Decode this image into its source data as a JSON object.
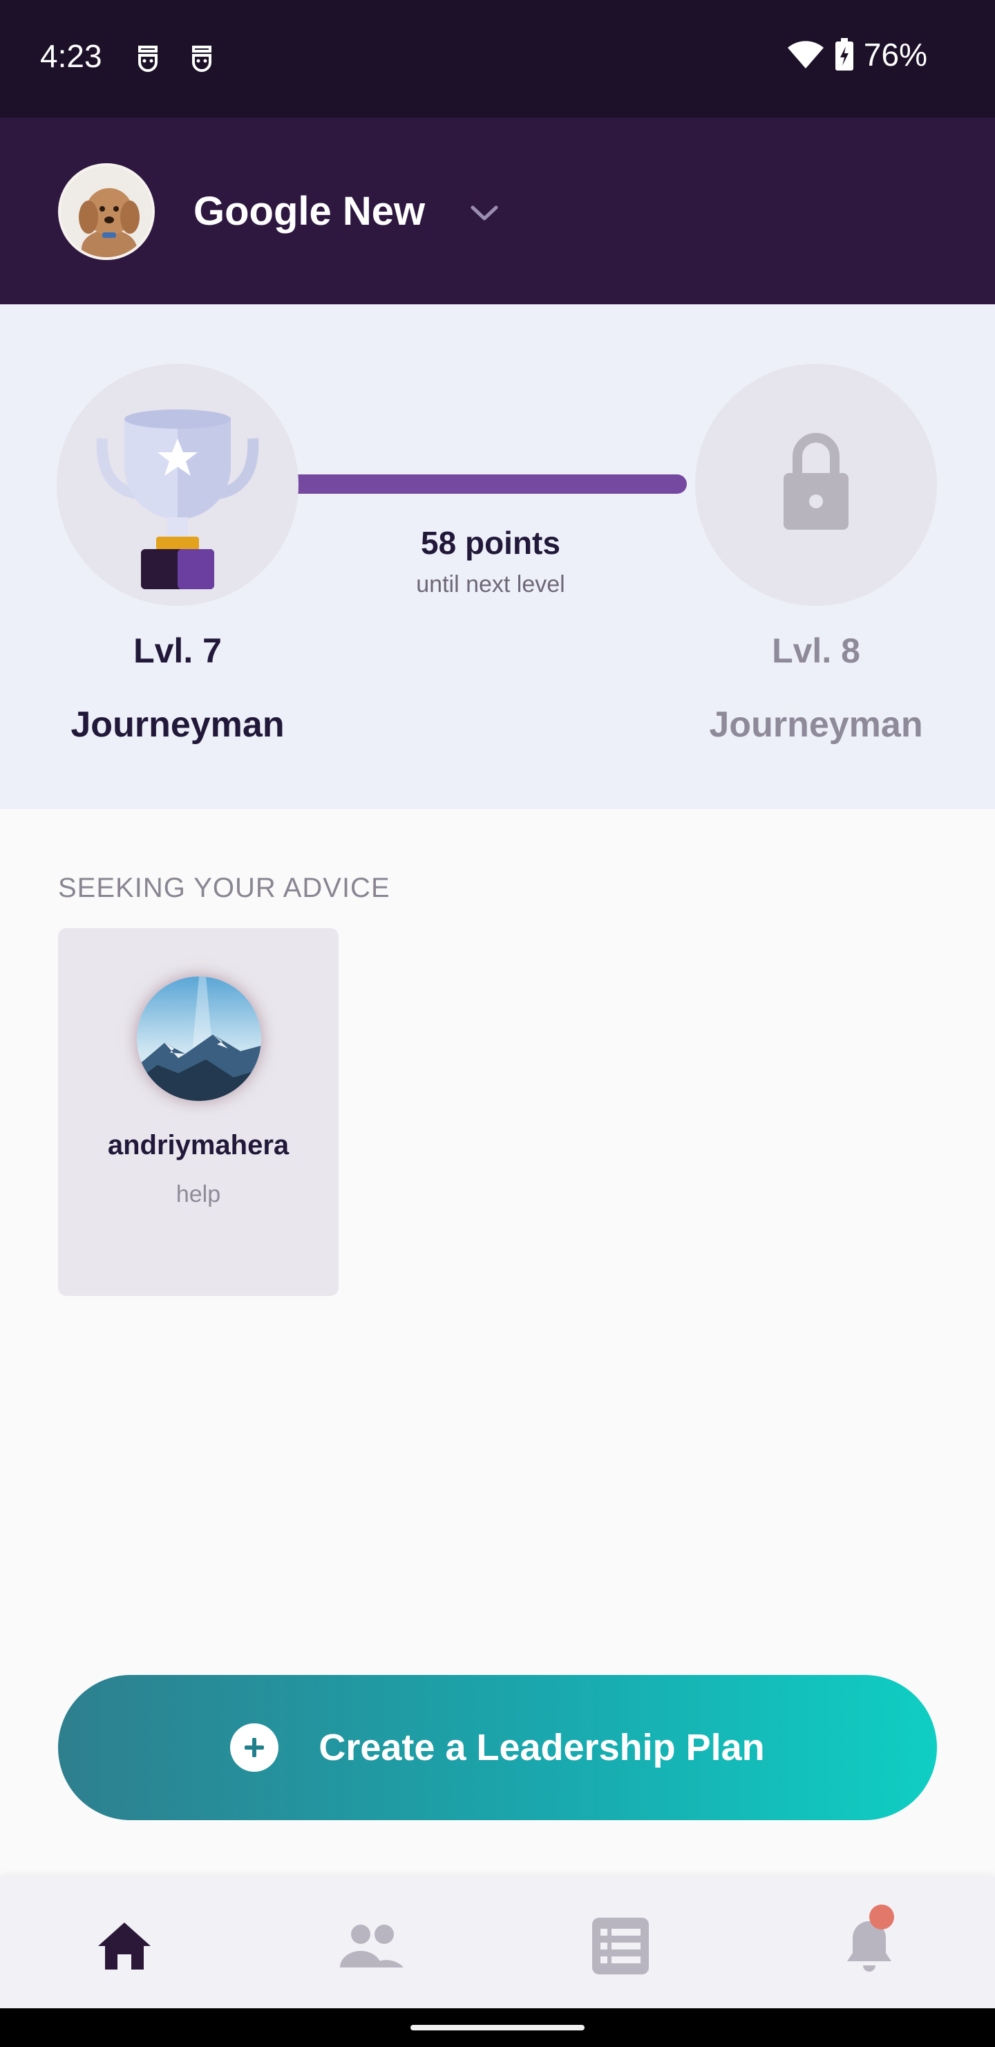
{
  "status_bar": {
    "time": "4:23",
    "battery": "76%",
    "icons": [
      "notification-icon",
      "notification-icon",
      "wifi-icon",
      "battery-charging-icon"
    ]
  },
  "header": {
    "org_name": "Google New",
    "icons": [
      "avatar",
      "chevron-down-icon"
    ]
  },
  "progress": {
    "points": "58 points",
    "points_caption": "until next level",
    "current_level": {
      "title": "Lvl. 7",
      "rank": "Journeyman",
      "icon": "trophy-icon"
    },
    "next_level": {
      "title": "Lvl. 8",
      "rank": "Journeyman",
      "icon": "lock-icon"
    },
    "accent_color": "#7649a1"
  },
  "advice": {
    "heading": "SEEKING YOUR ADVICE",
    "cards": [
      {
        "name": "andriymahera",
        "topic": "help"
      }
    ]
  },
  "cta": {
    "label": "Create a Leadership Plan",
    "icon": "plus-circle-icon",
    "gradient": [
      "#2e7f8e",
      "#0fcec3"
    ]
  },
  "bottom_nav": {
    "items": [
      {
        "icon": "home-icon",
        "active": true
      },
      {
        "icon": "people-icon",
        "active": false
      },
      {
        "icon": "list-icon",
        "active": false
      },
      {
        "icon": "bell-icon",
        "active": false,
        "badge": true
      }
    ]
  },
  "colors": {
    "header_bg": "#2e1840",
    "status_bg": "#1c1128",
    "section_bg": "#edf0f8",
    "notification_badge": "#e2786a"
  }
}
